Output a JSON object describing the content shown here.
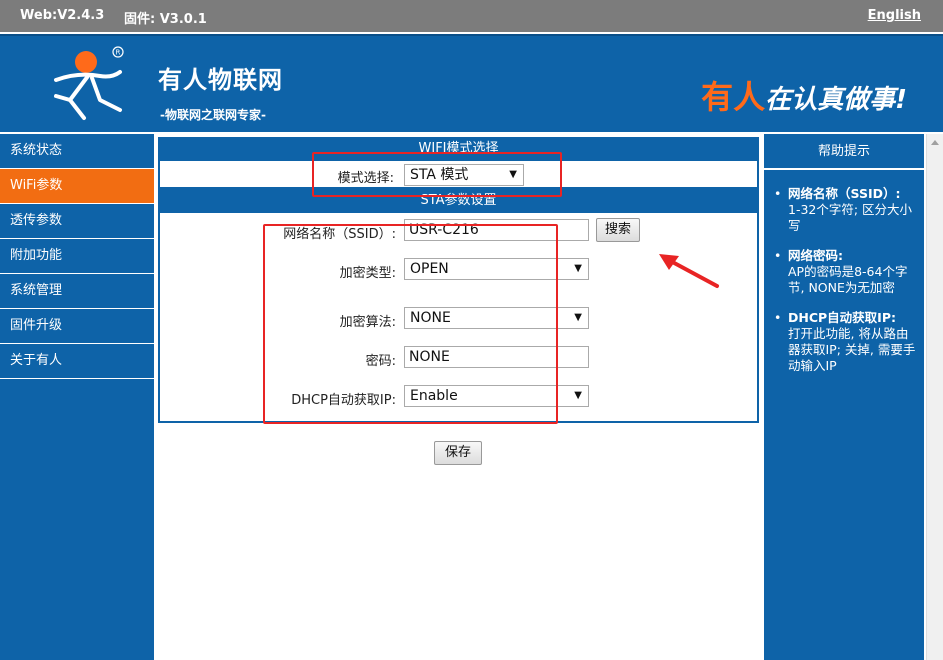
{
  "topbar": {
    "web_version": "Web:V2.4.3",
    "firmware_version": "固件: V3.0.1",
    "language_link": "English"
  },
  "header": {
    "brand_title": "有人物联网",
    "brand_subtitle": "-物联网之联网专家-",
    "slogan_red": "有人",
    "slogan_white": "在认真做事!"
  },
  "sidebar": {
    "items": [
      {
        "label": "系统状态"
      },
      {
        "label": "WiFi参数"
      },
      {
        "label": "透传参数"
      },
      {
        "label": "附加功能"
      },
      {
        "label": "系统管理"
      },
      {
        "label": "固件升级"
      },
      {
        "label": "关于有人"
      }
    ],
    "active_index": 1
  },
  "main": {
    "mode_section": {
      "title": "WIFI模式选择",
      "mode_label": "模式选择:",
      "mode_value": "STA 模式"
    },
    "sta_section": {
      "title": "STA参数设置",
      "ssid_label": "网络名称（SSID）:",
      "ssid_value": "USR-C216",
      "search_button": "搜索",
      "encrypt_type_label": "加密类型:",
      "encrypt_type_value": "OPEN",
      "encrypt_algo_label": "加密算法:",
      "encrypt_algo_value": "NONE",
      "password_label": "密码:",
      "password_value": "NONE",
      "dhcp_label": "DHCP自动获取IP:",
      "dhcp_value": "Enable"
    },
    "save_button": "保存"
  },
  "help": {
    "title": "帮助提示",
    "items": [
      {
        "title": "网络名称（SSID）:",
        "text": "1-32个字符; 区分大小写"
      },
      {
        "title": "网络密码:",
        "text": "AP的密码是8-64个字节, NONE为无加密"
      },
      {
        "title": "DHCP自动获取IP:",
        "text": "打开此功能, 将从路由器获取IP; 关掉, 需要手动输入IP"
      }
    ]
  },
  "colors": {
    "primary_blue": "#0e63a8",
    "active_orange": "#f26d12",
    "annotation_red": "#e82424",
    "topbar_gray": "#7c7c7c"
  }
}
